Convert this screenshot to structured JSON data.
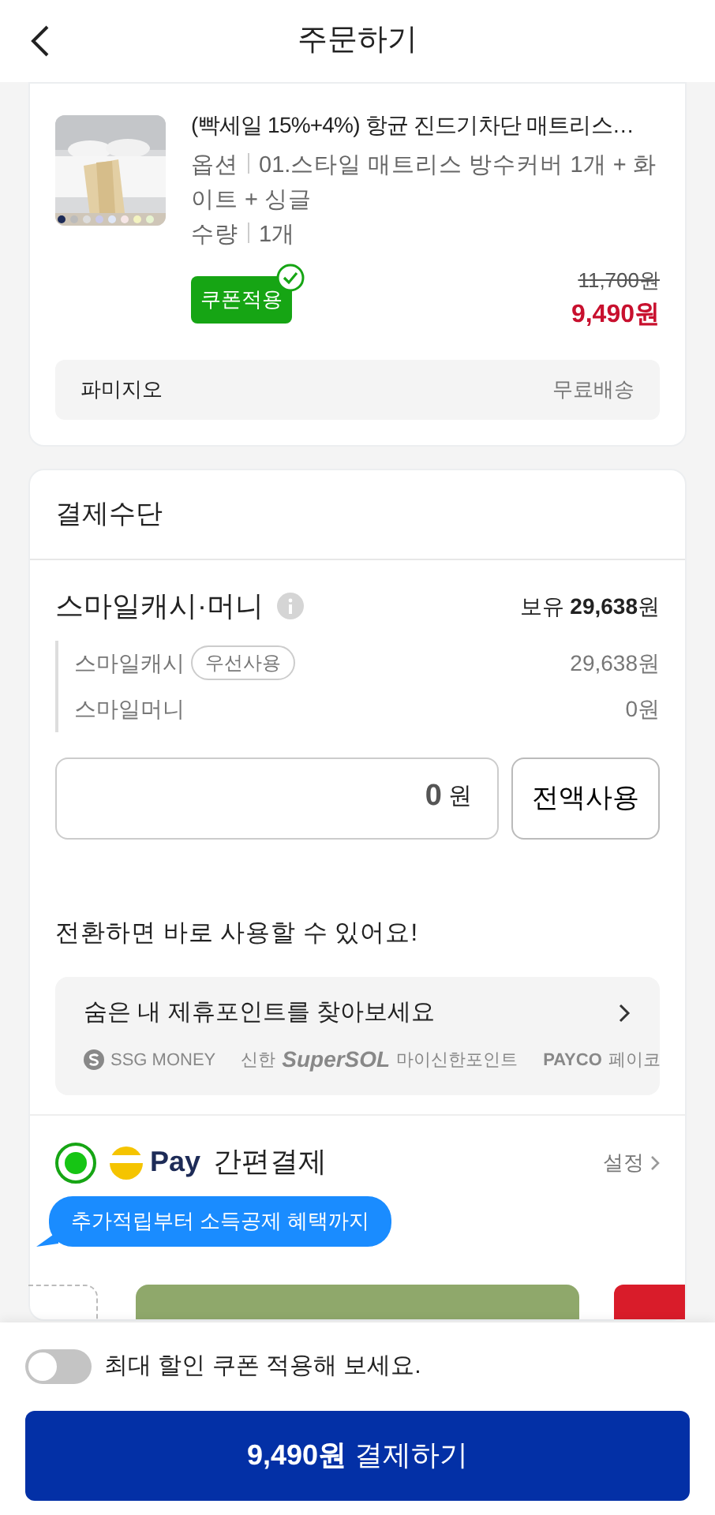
{
  "header": {
    "title": "주문하기"
  },
  "order_item": {
    "title": "(빡세일 15%+4%) 항균 진드기차단 매트리스…",
    "details": [
      {
        "label": "옵션",
        "value": "01.스타일 매트리스 방수커버 1개 + 화이트 + 싱글"
      },
      {
        "label": "수량",
        "value": "1개"
      }
    ],
    "coupon": {
      "label": "쿠폰적용",
      "applied": true
    },
    "original_price": "11,700원",
    "sale_price": "9,490원",
    "seller": "파미지오",
    "shipping": "무료배송"
  },
  "payment": {
    "title": "결제수단",
    "smile": {
      "title": "스마일캐시·머니",
      "balance": "보유 **29,638**원",
      "rows": [
        {
          "label": "스마일캐시",
          "tag": "우선사용",
          "amount": "29,638원"
        },
        {
          "label": "스마일머니",
          "amount": "0원"
        }
      ],
      "input": {
        "value": "0",
        "unit": "원"
      },
      "use_all_button": "전액사용"
    },
    "convert": {
      "heading": "전환하면 바로 사용할 수 있어요!",
      "banner_text": "숨은 내 제휴포인트를 찾아보세요",
      "partners": [
        {
          "kind": "ssg",
          "logo": "SSG MONEY"
        },
        {
          "kind": "shinhan",
          "logo": "신한",
          "logo_script": "SuperSOL",
          "name": "마이신한포인트"
        },
        {
          "kind": "payco",
          "logo": "PAYCO",
          "name": "페이코"
        }
      ]
    },
    "smilepay": {
      "selected": true,
      "logo_text": "Pay",
      "title": "간편결제",
      "settings": "설정",
      "tooltip": "추가적립부터 소득공제 혜택까지"
    }
  },
  "bottom": {
    "toggle": {
      "label": "최대 할인 쿠폰 적용해 보세요.",
      "on": false
    },
    "pay_button": "**9,490원** 결제하기"
  }
}
